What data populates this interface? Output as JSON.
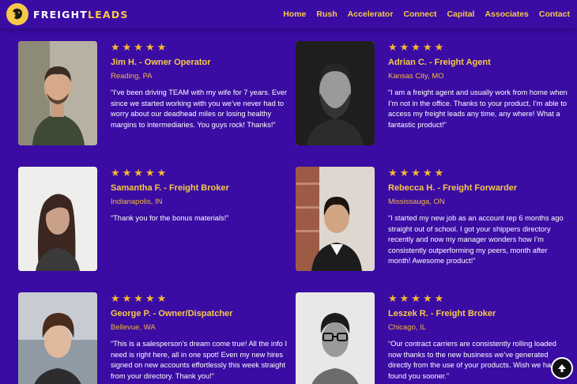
{
  "brand": {
    "part1": "FREIGHT",
    "part2": "LEADS",
    "icon": "lion-logo-icon"
  },
  "nav": [
    "Home",
    "Rush",
    "Accelerator",
    "Connect",
    "Capital",
    "Associates",
    "Contact"
  ],
  "testimonials": [
    {
      "rating": 5,
      "stars": "★★★★★",
      "name": "Jim H. - Owner Operator",
      "location": "Reading, PA",
      "quote": "“I’ve been driving TEAM with my wife for 7 years. Ever since we started working with you we’ve never had to worry about our deadhead miles or losing healthy margins to intermediaries. You guys rock! Thanks!”"
    },
    {
      "rating": 5,
      "stars": "★★★★★",
      "name": "Adrian C. - Freight Agent",
      "location": "Kansas City, MO",
      "quote": "“I am a freight agent and usually work from home when I’m not in the office. Thanks to your product, I’m able to access my freight leads any time, any where! What a fantastic product!”"
    },
    {
      "rating": 5,
      "stars": "★★★★★",
      "name": "Samantha F. - Freight Broker",
      "location": "Indianapolis, IN",
      "quote": "“Thank you for the bonus materials!”"
    },
    {
      "rating": 5,
      "stars": "★★★★★",
      "name": "Rebecca H. - Freight Forwarder",
      "location": "Mississauga, ON",
      "quote": "“I started my new job as an account rep 6 months ago straight out of school. I got your shippers directory recently and now my manager wonders how I’m consistently outperforming my peers, month after month! Awesome product!”"
    },
    {
      "rating": 5,
      "stars": "★★★★★",
      "name": "George P. - Owner/Dispatcher",
      "location": "Bellevue, WA",
      "quote": "“This is a salesperson’s dream come true! All the info I need is right here, all in one spot! Even my new hires signed on new accounts effortlessly this week straight from your directory. Thank you!”"
    },
    {
      "rating": 5,
      "stars": "★★★★★",
      "name": "Leszek R. - Freight Broker",
      "location": "Chicago, IL",
      "quote": "“Our contract carriers are consistently rolling loaded now thanks to the new business we’ve generated directly from the use of your products. Wish we had found you sooner.”"
    }
  ],
  "colors": {
    "background": "#3a0ca3",
    "accent": "#f7c948",
    "stars": "#f7b733"
  },
  "scroll_top": {
    "icon": "arrow-up-icon"
  }
}
